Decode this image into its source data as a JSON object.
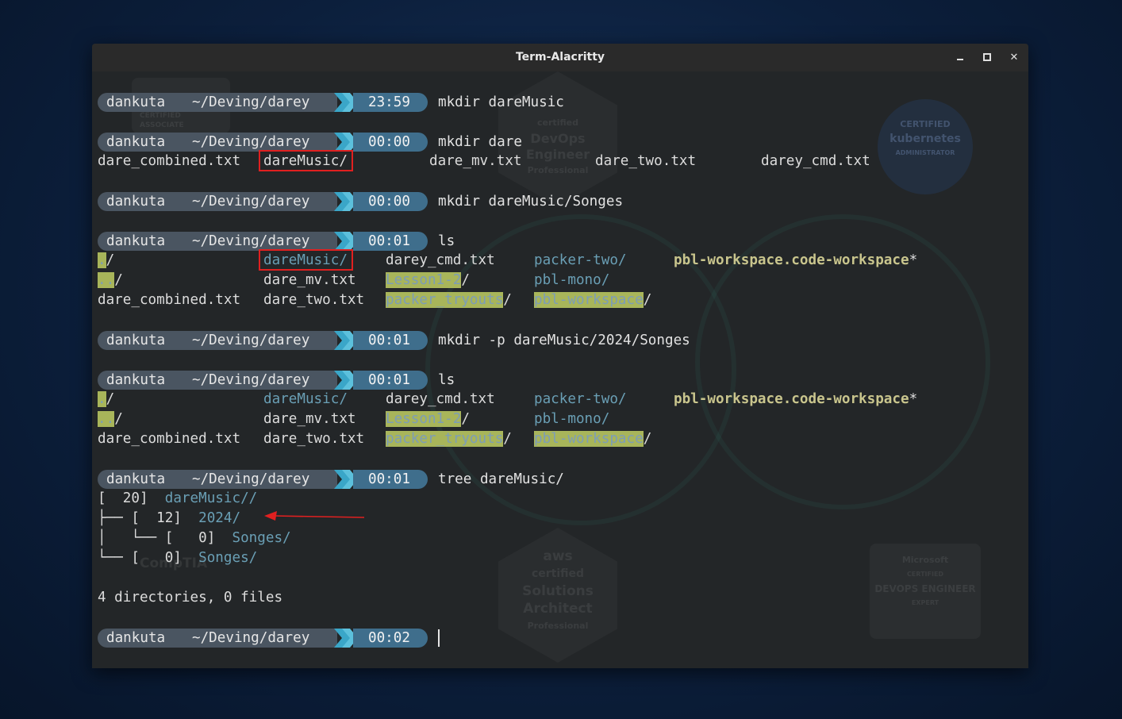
{
  "window": {
    "title": "Term-Alacritty"
  },
  "prompt": {
    "user": "dankuta",
    "dir": "~/Deving/darey"
  },
  "blocks": {
    "b1": {
      "time": "23:59",
      "cmd": "mkdir dareMusic"
    },
    "b2": {
      "time": "00:00",
      "cmd": "mkdir dare",
      "out": [
        "dare_combined.txt",
        "dareMusic/",
        "dare_mv.txt",
        "dare_two.txt",
        "darey_cmd.txt"
      ]
    },
    "b3": {
      "time": "00:00",
      "cmd": "mkdir dareMusic/Songes"
    },
    "b4": {
      "time": "00:01",
      "cmd": "ls"
    },
    "b5": {
      "time": "00:01",
      "cmd": "mkdir -p dareMusic/2024/Songes"
    },
    "b6": {
      "time": "00:01",
      "cmd": "ls"
    },
    "b7": {
      "time": "00:01",
      "cmd": "tree dareMusic/"
    },
    "b8": {
      "time": "00:02",
      "cmd": ""
    }
  },
  "ls": {
    "dot": ".",
    "dotdot": "..",
    "slash": "/",
    "dare_combined": "dare_combined.txt",
    "dareMusic": "dareMusic/",
    "dare_mv": "dare_mv.txt",
    "dare_two": "dare_two.txt",
    "darey_cmd": "darey_cmd.txt",
    "lesson": "Lesson1-2",
    "packer_tryouts": "packer_tryouts",
    "packer_two": "packer-two/",
    "pbl_mono": "pbl-mono/",
    "pbl_workspace": "pbl-workspace",
    "workspace_file": "pbl-workspace.code-workspace",
    "star": "*"
  },
  "tree": {
    "l1_prefix": "[  20]",
    "l1_name": "dareMusic//",
    "l2_prefix": "├── [  12]",
    "l2_name": "2024/",
    "l3_prefix": "│   └── [   0]",
    "l3_name": "Songes/",
    "l4_prefix": "└── [   0]",
    "l4_name": "Songes/",
    "summary": "4 directories, 0 files"
  },
  "wallpaper": {
    "aws1_line1": "aws",
    "aws1_line2": "certified",
    "aws1_line3": "DevOps",
    "aws1_line4": "Engineer",
    "aws1_line5": "Professional",
    "aws2_line1": "aws",
    "aws2_line2": "certified",
    "aws2_line3": "Solutions",
    "aws2_line4": "Architect",
    "aws2_line5": "Professional",
    "k8s_line1": "CERTIFIED",
    "k8s_line2": "kubernetes",
    "k8s_line3": "ADMINISTRATOR",
    "ms_line1": "Microsoft",
    "ms_line2": "CERTIFIED",
    "ms_line3": "DEVOPS ENGINEER",
    "ms_line4": "EXPERT",
    "tf_line1": "CERTIFIED",
    "tf_line2": "ASSOCIATE",
    "comptia": "CompTIA"
  },
  "colors": {
    "prompt_segment": "#4a5561",
    "time_segment": "#3f6e8c",
    "arrow_accent": "#3aa6c8",
    "directory": "#6a9fb5",
    "highlight_bg": "#a8b55a",
    "annotation_red": "#e02020"
  }
}
